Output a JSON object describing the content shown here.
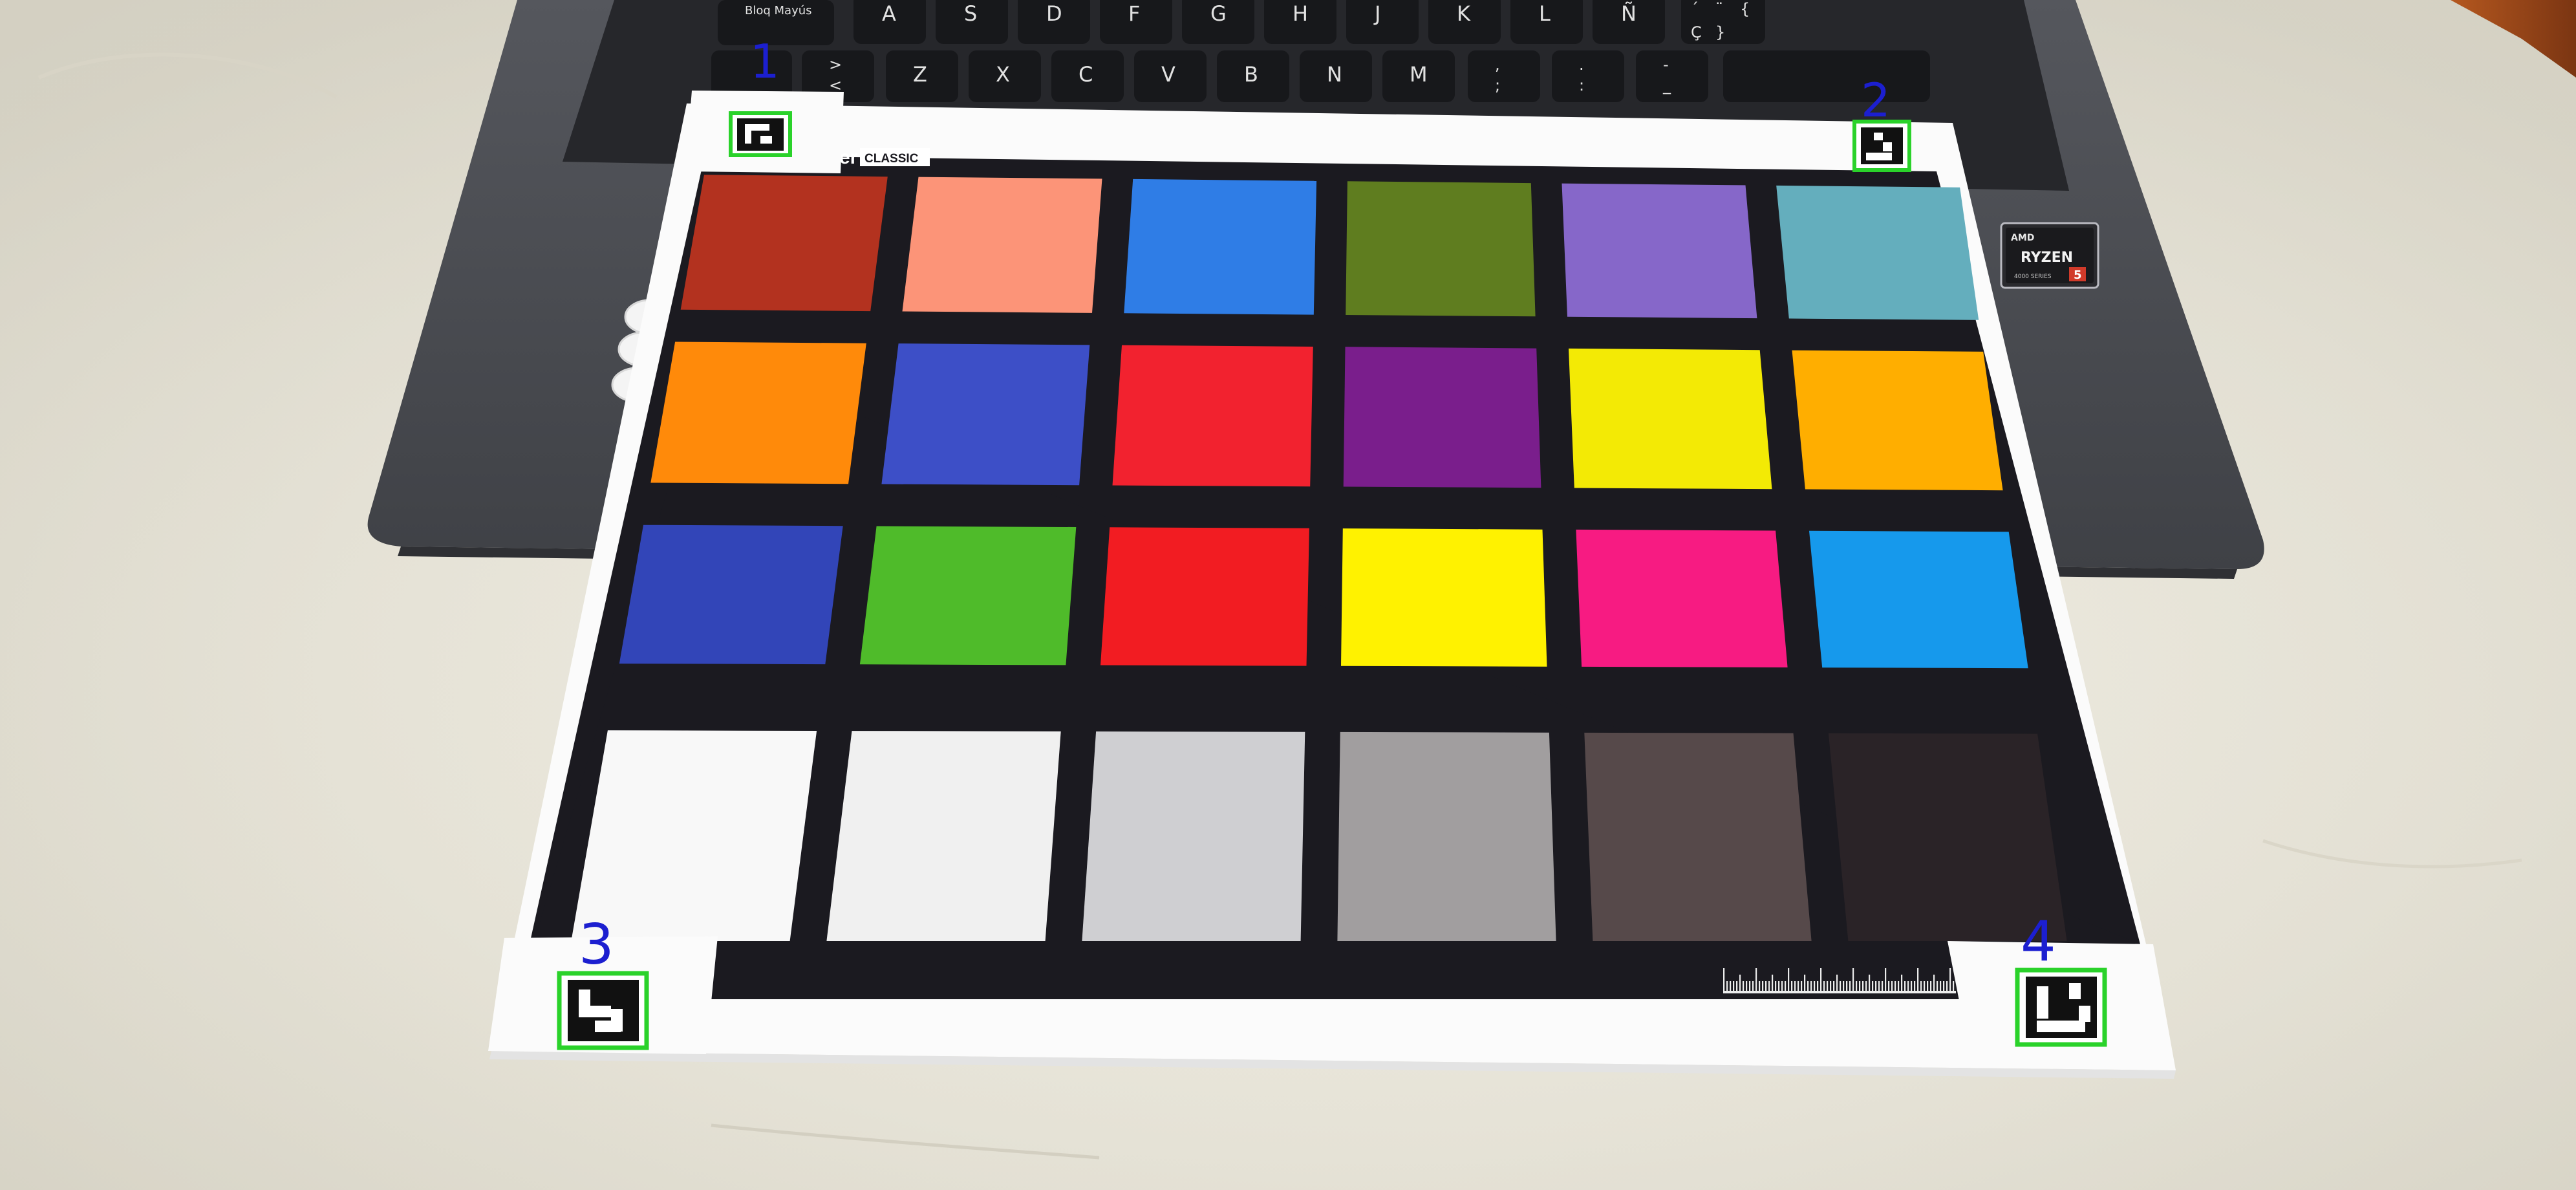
{
  "laptop": {
    "keyboard_row_upper": [
      "A",
      "S",
      "D",
      "F",
      "G",
      "H",
      "J",
      "K",
      "L",
      "Ñ"
    ],
    "keyboard_row_upper_extra": [
      "´",
      "¨",
      "{",
      "Ç",
      "}"
    ],
    "keyboard_row_lower": [
      "Z",
      "X",
      "C",
      "V",
      "B",
      "N",
      "M"
    ],
    "keyboard_row_lower_extra": [
      "<",
      ">",
      ";",
      ",",
      ":",
      ".",
      "_",
      "-"
    ],
    "caps_lock_label": "Bloq Mayús",
    "cpu_sticker": {
      "brand": "AMD",
      "name": "RYZEN",
      "series": "4000 SERIES",
      "number": "5"
    }
  },
  "checker": {
    "brand_text": "er",
    "brand_badge": "CLASSIC",
    "patch_colors": [
      [
        "#b3321f",
        "#fc9478",
        "#2f7de6",
        "#5f7d1f",
        "#8667c9",
        "#64aebd"
      ],
      [
        "#ff8a0a",
        "#3d4fc7",
        "#f2222f",
        "#7a1e8c",
        "#f3ea05",
        "#ffae00"
      ],
      [
        "#3245b8",
        "#4fbb2a",
        "#f21c22",
        "#fff200",
        "#f71b82",
        "#1699ec"
      ],
      [
        "#f8f8f8",
        "#f0f0f0",
        "#cfcfd2",
        "#a19e9f",
        "#56494a",
        "#2a2327"
      ]
    ]
  },
  "markers": [
    {
      "label": "1"
    },
    {
      "label": "2"
    },
    {
      "label": "3"
    },
    {
      "label": "4"
    }
  ],
  "colors": {
    "laptop_body": "#4a4c52",
    "keyboard_well": "#26272b",
    "key": "#17181b",
    "chart_background": "#1b1a20",
    "paper": "#fbfbfb",
    "marker_outline": "#2ad22a",
    "marker_number": "#1c1fd0"
  }
}
